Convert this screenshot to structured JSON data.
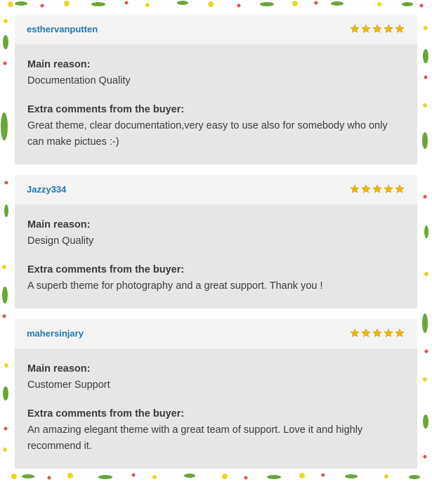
{
  "reviews": [
    {
      "username": "esthervanputten",
      "rating": 5,
      "main_reason_label": "Main reason:",
      "main_reason": "Documentation Quality",
      "comments_label": "Extra comments from the buyer:",
      "comments": "Great theme, clear documentation,very easy to use also for somebody who only can make pictues :-)"
    },
    {
      "username": "Jazzy334",
      "rating": 5,
      "main_reason_label": "Main reason:",
      "main_reason": "Design Quality",
      "comments_label": "Extra comments from the buyer:",
      "comments": "A superb theme for photography and a great support. Thank you !"
    },
    {
      "username": "mahersinjary",
      "rating": 5,
      "main_reason_label": "Main reason:",
      "main_reason": "Customer Support",
      "comments_label": "Extra comments from the buyer:",
      "comments": "An amazing elegant theme with a great team of support. Love it and highly recommend it."
    }
  ],
  "colors": {
    "username": "#1f78b4",
    "star": "#f5b800",
    "header_bg": "#f4f4f4",
    "body_bg": "#e6e6e6"
  },
  "decoration": "floral-border"
}
